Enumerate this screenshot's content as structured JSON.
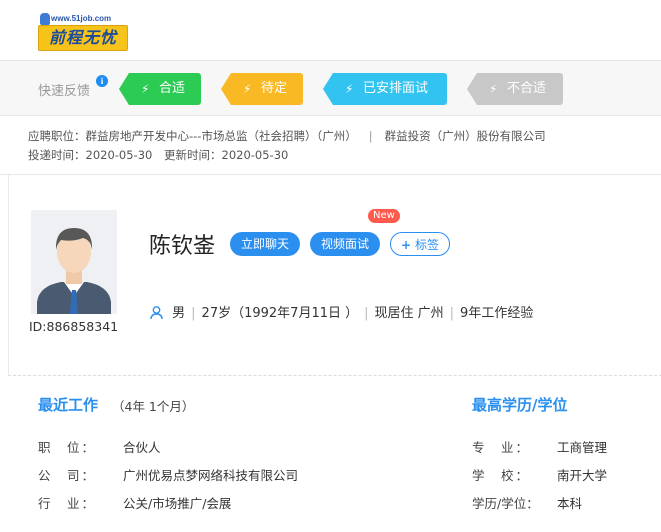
{
  "header": {
    "logo_url_text": "www.51job.com",
    "logo_text": "前程无忧"
  },
  "feedback": {
    "label": "快速反馈",
    "info_icon": "i",
    "tags": [
      {
        "label": "合适",
        "color": "#2ccb54",
        "icon": "bolt-icon"
      },
      {
        "label": "待定",
        "color": "#f9b925",
        "icon": "bolt-icon"
      },
      {
        "label": "已安排面试",
        "color": "#33c3f1",
        "icon": "bolt-icon"
      },
      {
        "label": "不合适",
        "color": "#c8c8c8",
        "icon": "bolt-icon"
      }
    ]
  },
  "application": {
    "position_label": "应聘职位：",
    "position": "群益房地产开发中心---市场总监（社会招聘）（广州）",
    "separator": "|",
    "company": "群益投资（广州）股份有限公司",
    "delivery_label": "投递时间：",
    "delivery_date": "2020-05-30",
    "update_label": "更新时间：",
    "update_date": "2020-05-30"
  },
  "profile": {
    "name": "陈钦崟",
    "id_label": "ID:886858341",
    "buttons": {
      "chat": "立即聊天",
      "video": "视频面试",
      "tag": "标签"
    },
    "new_badge": "New",
    "gender": "男",
    "age": "27岁（1992年7月11日 ）",
    "residence": "现居住 广州",
    "experience": "9年工作经验"
  },
  "recent_work": {
    "title": "最近工作",
    "duration": "（4年 1个月）",
    "rows": [
      {
        "key": "职　位：",
        "value": "合伙人"
      },
      {
        "key": "公　司：",
        "value": "广州优易点梦网络科技有限公司"
      },
      {
        "key": "行　业：",
        "value": "公关/市场推广/会展"
      }
    ]
  },
  "education": {
    "title": "最高学历/学位",
    "rows": [
      {
        "key": "专　业：",
        "value": "工商管理"
      },
      {
        "key": "学　校：",
        "value": "南开大学"
      },
      {
        "key": "学历/学位：",
        "value": "本科"
      }
    ]
  }
}
